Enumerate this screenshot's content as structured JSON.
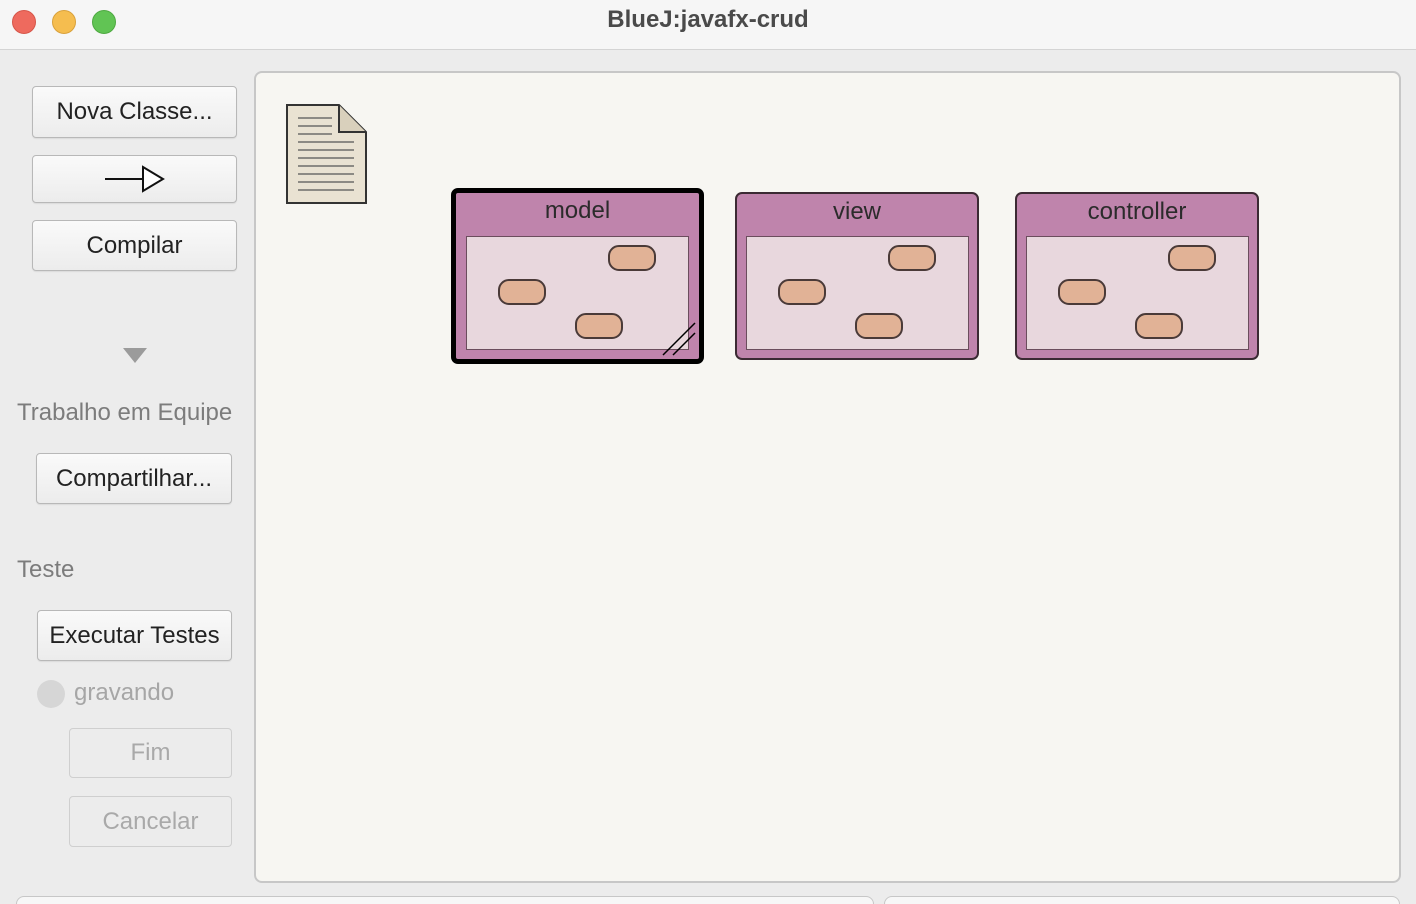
{
  "window": {
    "title": "BlueJ:javafx-crud"
  },
  "toolbar": {
    "new_class": "Nova Classe...",
    "compile": "Compilar",
    "team_label": "Trabalho em Equipe",
    "share": "Compartilhar...",
    "test_label": "Teste",
    "run_tests": "Executar Testes",
    "recording": "gravando",
    "end": "Fim",
    "cancel": "Cancelar"
  },
  "diagram": {
    "packages": [
      {
        "name": "model",
        "selected": true
      },
      {
        "name": "view",
        "selected": false
      },
      {
        "name": "controller",
        "selected": false
      }
    ]
  },
  "colors": {
    "package_fill": "#bf84ac",
    "package_inner": "#e8d7dd",
    "class_fill": "#e1b296",
    "canvas": "#f7f6f2"
  }
}
